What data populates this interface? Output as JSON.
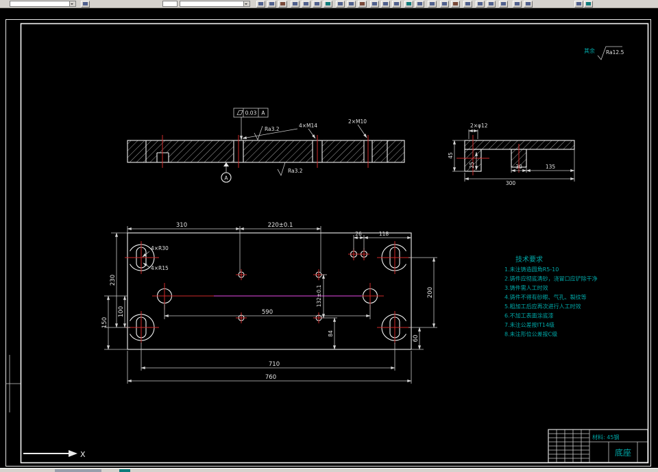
{
  "surface_default": {
    "prefix": "其余",
    "value": "Ra12.5"
  },
  "front_section": {
    "fcf_symbol": "flatness",
    "fcf_tolerance": "0.03",
    "fcf_datum": "A",
    "thread_label_1": "4×M14",
    "thread_label_2": "2×M10",
    "ra_top": "Ra3.2",
    "ra_bottom": "Ra3.2",
    "datum_label": "A"
  },
  "side_section": {
    "hole_label": "2×φ12",
    "dim_45": "45",
    "dim_25": "25",
    "dim_30": "30",
    "dim_135": "135",
    "dim_300": "300"
  },
  "plan_view": {
    "dim_310": "310",
    "dim_220": "220±0.1",
    "dim_26": "26",
    "dim_118": "118",
    "dim_230": "230",
    "dim_100": "100",
    "dim_150": "150",
    "dim_590": "590",
    "dim_132": "132±0.1",
    "dim_84": "84",
    "dim_200": "200",
    "dim_60": "60",
    "dim_710": "710",
    "dim_760": "760",
    "label_r30": "4×R30",
    "label_r15": "4×R15"
  },
  "tech_requirements": {
    "title": "技术要求",
    "lines": [
      "1.未注铸造圆角R5-10",
      "2.铸件应彻底清砂，浇冒口应铲除干净",
      "3.铸件需人工时效",
      "4.铸件不得有砂眼、气孔、裂纹等",
      "5.粗加工后应再次进行人工时效",
      "6.不加工表面涂底漆",
      "7.未注公差按IT14级",
      "8.未注形位公差按C级"
    ]
  },
  "title_block": {
    "material": "材料: 45钢",
    "part_name": "底座"
  },
  "ucs": {
    "x_label": "X"
  }
}
